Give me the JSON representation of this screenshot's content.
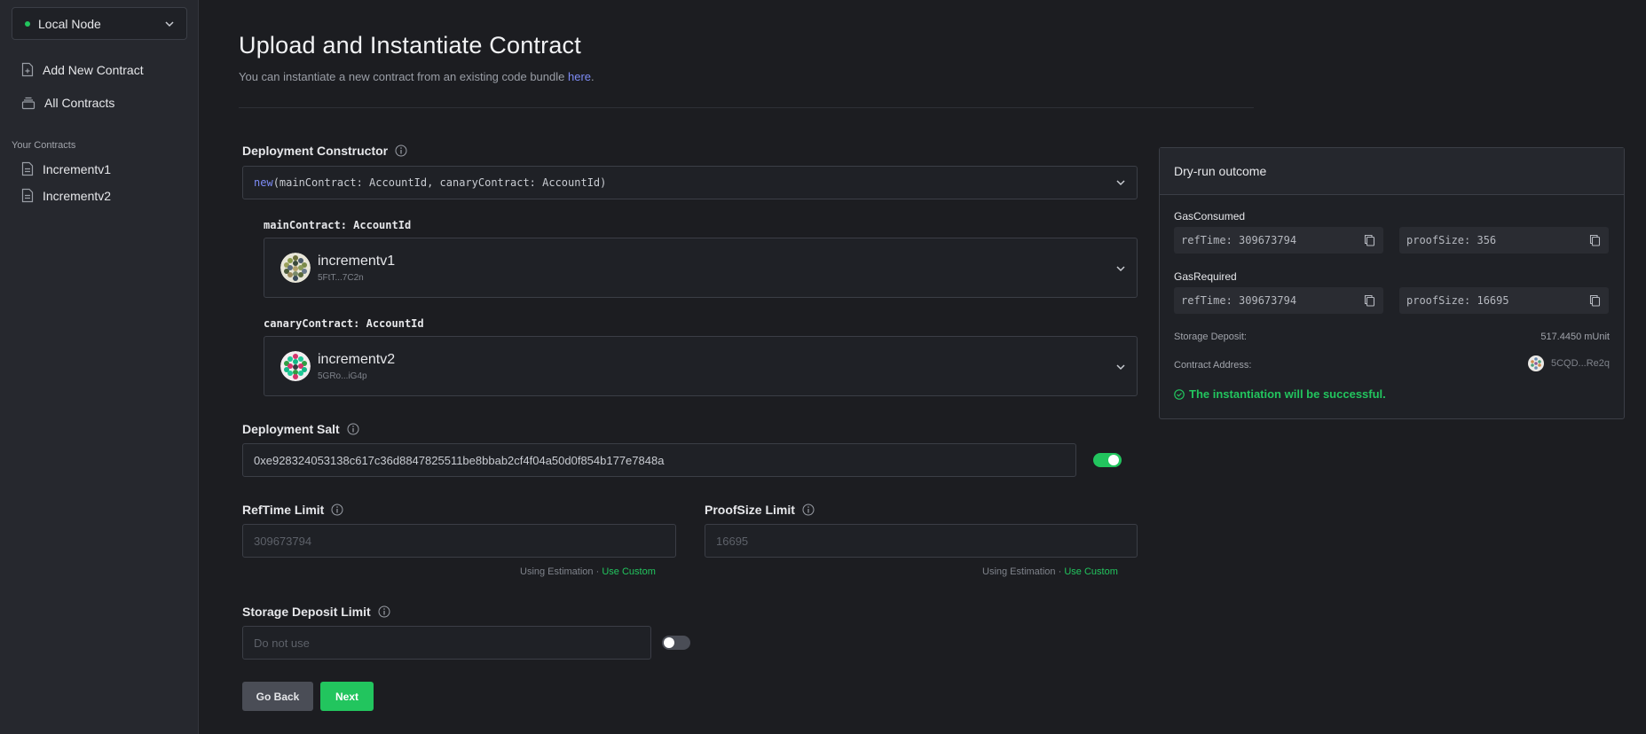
{
  "sidebar": {
    "node_label": "Local Node",
    "add_contract": "Add New Contract",
    "all_contracts": "All Contracts",
    "your_contracts_label": "Your Contracts",
    "contracts": [
      "Incrementv1",
      "Incrementv2"
    ]
  },
  "main": {
    "title": "Upload and Instantiate Contract",
    "subtitle": "You can instantiate a new contract from an existing code bundle ",
    "subtitle_link": "here",
    "subtitle_end": ".",
    "constructor_label": "Deployment Constructor",
    "constructor_fn": "new",
    "constructor_args": "(mainContract: AccountId, canaryContract: AccountId)",
    "arg1_label": "mainContract: AccountId",
    "arg1_name": "incrementv1",
    "arg1_addr": "5FtT...7C2n",
    "arg2_label": "canaryContract: AccountId",
    "arg2_name": "incrementv2",
    "arg2_addr": "5GRo...iG4p",
    "salt_label": "Deployment Salt",
    "salt_value": "0xe928324053138c617c36d8847825511be8bbab2cf4f04a50d0f854b177e7848a",
    "salt_enabled": true,
    "reftime_label": "RefTime Limit",
    "reftime_placeholder": "309673794",
    "proofsize_label": "ProofSize Limit",
    "proofsize_placeholder": "16695",
    "using_estimation": "Using Estimation",
    "sep": "·",
    "use_custom": "Use Custom",
    "storage_label": "Storage Deposit Limit",
    "storage_placeholder": "Do not use",
    "storage_enabled": false,
    "back_button": "Go Back",
    "next_button": "Next"
  },
  "dryrun": {
    "title": "Dry-run outcome",
    "gas_consumed_label": "GasConsumed",
    "gas_consumed_reftime": "refTime: 309673794",
    "gas_consumed_proof": "proofSize: 356",
    "gas_required_label": "GasRequired",
    "gas_required_reftime": "refTime: 309673794",
    "gas_required_proof": "proofSize: 16695",
    "storage_label": "Storage Deposit:",
    "storage_value": "517.4450 mUnit",
    "address_label": "Contract Address:",
    "address_value": "5CQD...Re2q",
    "success_text": "The instantiation will be successful."
  },
  "colors": {
    "accent_green": "#22c55e",
    "link_blue": "#7d8bf5"
  }
}
